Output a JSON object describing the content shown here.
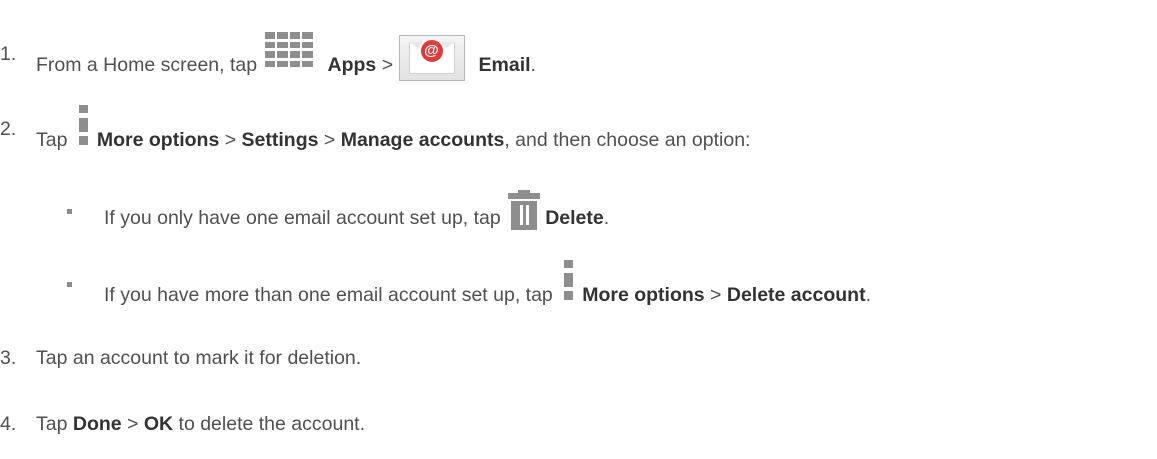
{
  "steps": [
    {
      "number": "1.",
      "prefix": "From a Home screen, tap",
      "apps_label": "Apps",
      "separator": ">",
      "email_label": "Email",
      "suffix": "."
    },
    {
      "number": "2.",
      "prefix": "Tap",
      "more_label": "More options",
      "sep1": ">",
      "settings_label": "Settings",
      "sep2": ">",
      "manage_label": "Manage accounts",
      "suffix": ", and then choose an option:"
    },
    {
      "number": "3.",
      "text": "Tap an account to mark it for deletion."
    },
    {
      "number": "4.",
      "prefix": "Tap",
      "done_label": "Done",
      "separator": ">",
      "ok_label": "OK",
      "suffix": "to delete the account."
    }
  ],
  "substeps": [
    {
      "prefix": "If you only have one email account set up, tap",
      "delete_label": "Delete",
      "suffix": "."
    },
    {
      "prefix": "If you have more than one email account set up, tap",
      "more_label": "More options",
      "separator": ">",
      "delete_account_label": "Delete account",
      "suffix": "."
    }
  ],
  "icons": {
    "apps": "apps-grid-icon",
    "email": "email-app-icon",
    "more_options": "more-options-icon",
    "delete": "trash-icon"
  },
  "colors": {
    "text": "#505050",
    "bold_text": "#333333",
    "icon_gray": "#8e8e8e",
    "email_seal_red": "#e23a3a"
  }
}
